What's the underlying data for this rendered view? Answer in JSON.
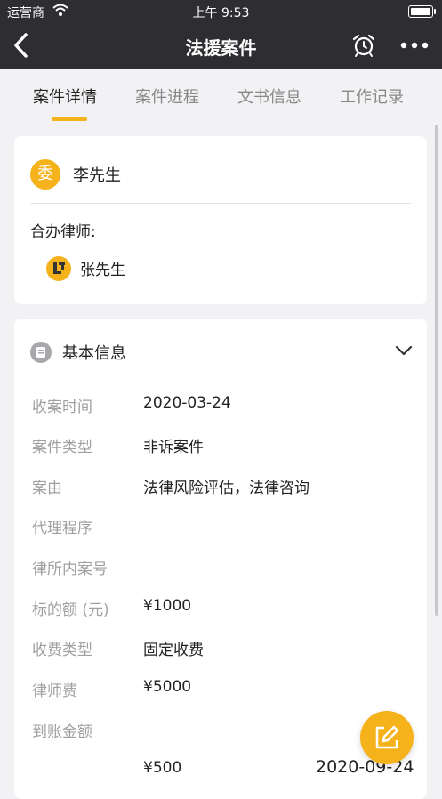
{
  "status_bar": {
    "carrier": "运营商",
    "time": "上午 9:53"
  },
  "nav": {
    "title": "法援案件"
  },
  "tabs": [
    {
      "label": "案件详情",
      "active": true
    },
    {
      "label": "案件进程",
      "active": false
    },
    {
      "label": "文书信息",
      "active": false
    },
    {
      "label": "工作记录",
      "active": false
    }
  ],
  "client": {
    "avatar_text": "委",
    "name": "李先生"
  },
  "co_lawyers": {
    "label": "合办律师:",
    "lawyers": [
      {
        "name": "张先生",
        "logo_icon": "law-firm-logo-icon"
      }
    ]
  },
  "basic_info": {
    "title": "基本信息",
    "rows": [
      {
        "label": "收案时间",
        "value": "2020-03-24"
      },
      {
        "label": "案件类型",
        "value": "非诉案件"
      },
      {
        "label": "案由",
        "value": "法律风险评估，法律咨询"
      },
      {
        "label": "代理程序",
        "value": ""
      },
      {
        "label": "律所内案号",
        "value": ""
      },
      {
        "label": "标的额 (元)",
        "value": "¥1000"
      },
      {
        "label": "收费类型",
        "value": "固定收费"
      },
      {
        "label": "律师费",
        "value": "¥5000"
      },
      {
        "label": "到账金额",
        "value": ""
      }
    ],
    "received": {
      "amount": "¥500",
      "date": "2020-09-24"
    }
  },
  "colors": {
    "accent": "#f5b21b",
    "header_bg": "#2e2e32",
    "page_bg": "#f2f2f5"
  },
  "icons": [
    "back-icon",
    "alarm-clock-icon",
    "more-icon",
    "document-icon",
    "chevron-down-icon",
    "edit-icon",
    "wifi-icon",
    "battery-icon"
  ]
}
